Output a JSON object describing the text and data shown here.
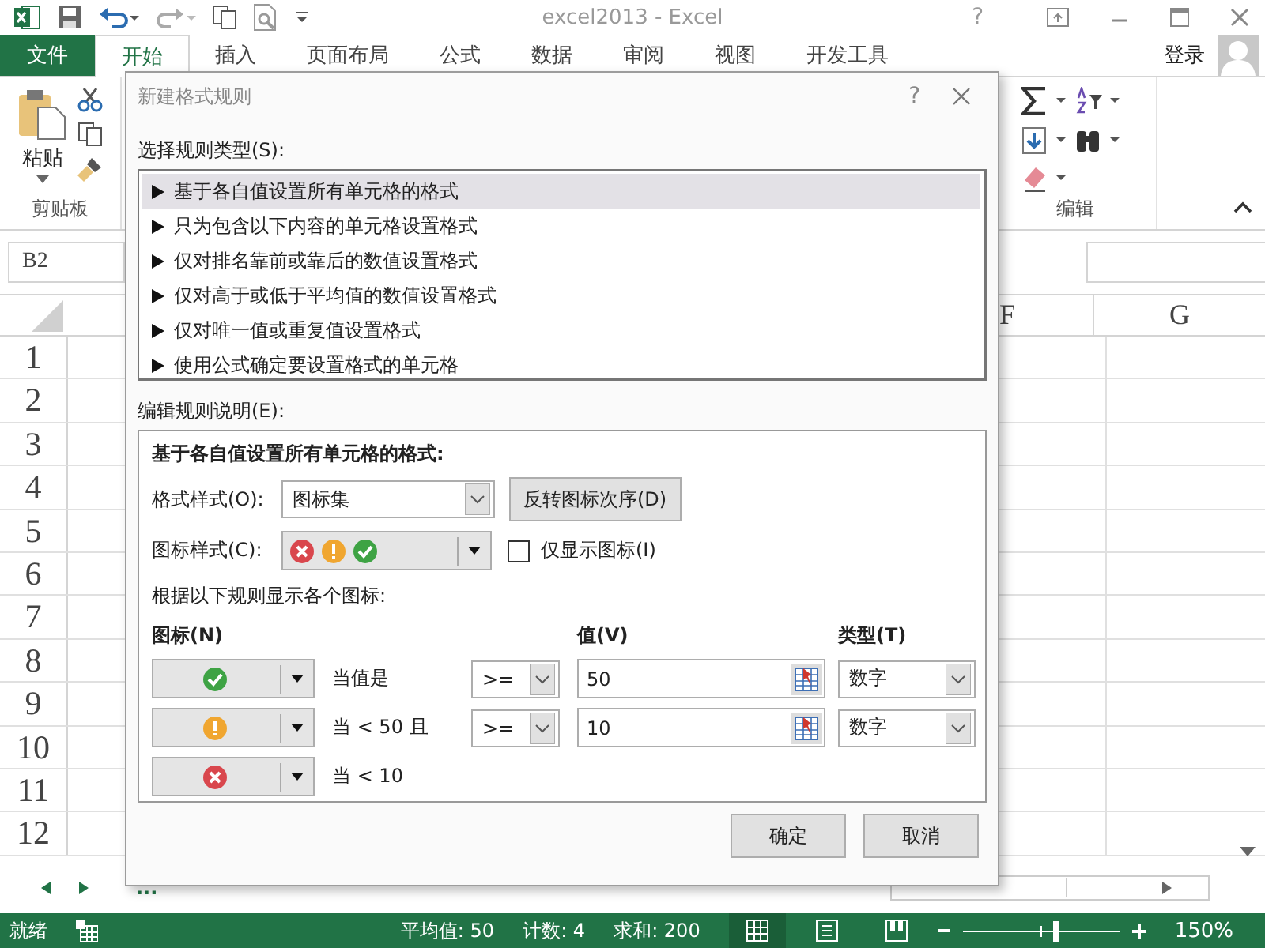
{
  "title_bar": {
    "title": "excel2013 - Excel",
    "help": "?"
  },
  "ribbon_tabs": [
    {
      "label": "文件",
      "kind": "file",
      "selected": false
    },
    {
      "label": "开始",
      "kind": "tab",
      "selected": true
    },
    {
      "label": "插入",
      "kind": "tab",
      "selected": false
    },
    {
      "label": "页面布局",
      "kind": "tab",
      "selected": false
    },
    {
      "label": "公式",
      "kind": "tab",
      "selected": false
    },
    {
      "label": "数据",
      "kind": "tab",
      "selected": false
    },
    {
      "label": "审阅",
      "kind": "tab",
      "selected": false
    },
    {
      "label": "视图",
      "kind": "tab",
      "selected": false
    },
    {
      "label": "开发工具",
      "kind": "tab",
      "selected": false
    }
  ],
  "sign_in": "登录",
  "clipboard_group": {
    "paste": "粘贴",
    "label": "剪贴板"
  },
  "editing_group": {
    "label": "编辑"
  },
  "name_box": "B2",
  "column_headers": [
    "F",
    "G"
  ],
  "row_headers": [
    "1",
    "2",
    "3",
    "4",
    "5",
    "6",
    "7",
    "8",
    "9",
    "10",
    "11",
    "12"
  ],
  "sheet_nav": {
    "more": "..."
  },
  "dialog": {
    "title": "新建格式规则",
    "help": "?",
    "rule_type_label": "选择规则类型(S):",
    "rule_types": [
      {
        "label": "基于各自值设置所有单元格的格式",
        "selected": true
      },
      {
        "label": "只为包含以下内容的单元格设置格式",
        "selected": false
      },
      {
        "label": "仅对排名靠前或靠后的数值设置格式",
        "selected": false
      },
      {
        "label": "仅对高于或低于平均值的数值设置格式",
        "selected": false
      },
      {
        "label": "仅对唯一值或重复值设置格式",
        "selected": false
      },
      {
        "label": "使用公式确定要设置格式的单元格",
        "selected": false
      }
    ],
    "edit_label": "编辑规则说明(E):",
    "heading": "基于各自值设置所有单元格的格式:",
    "format_style": {
      "label": "格式样式(O):",
      "value": "图标集"
    },
    "reverse_button": "反转图标次序(D)",
    "icon_style": {
      "label": "图标样式(C):",
      "icons": [
        {
          "kind": "cross"
        },
        {
          "kind": "exclaim"
        },
        {
          "kind": "check"
        }
      ]
    },
    "icons_only": {
      "label": "仅显示图标(I)",
      "checked": false
    },
    "hint": "根据以下规则显示各个图标:",
    "column_heads": {
      "icon": "图标(N)",
      "value": "值(V)",
      "type": "类型(T)"
    },
    "rules": [
      {
        "kind": "check",
        "condition": "当值是",
        "operator": ">=",
        "value": "50",
        "type": "数字"
      },
      {
        "kind": "exclaim",
        "condition": "当 < 50 且",
        "operator": ">=",
        "value": "10",
        "type": "数字"
      },
      {
        "kind": "cross",
        "condition": "当 < 10"
      }
    ],
    "buttons": [
      "确定",
      "取消"
    ]
  },
  "status_bar": {
    "ready": "就绪",
    "average": "平均值: 50",
    "count": "计数: 4",
    "sum": "求和: 200",
    "zoom": "150%",
    "level": 0.6
  }
}
